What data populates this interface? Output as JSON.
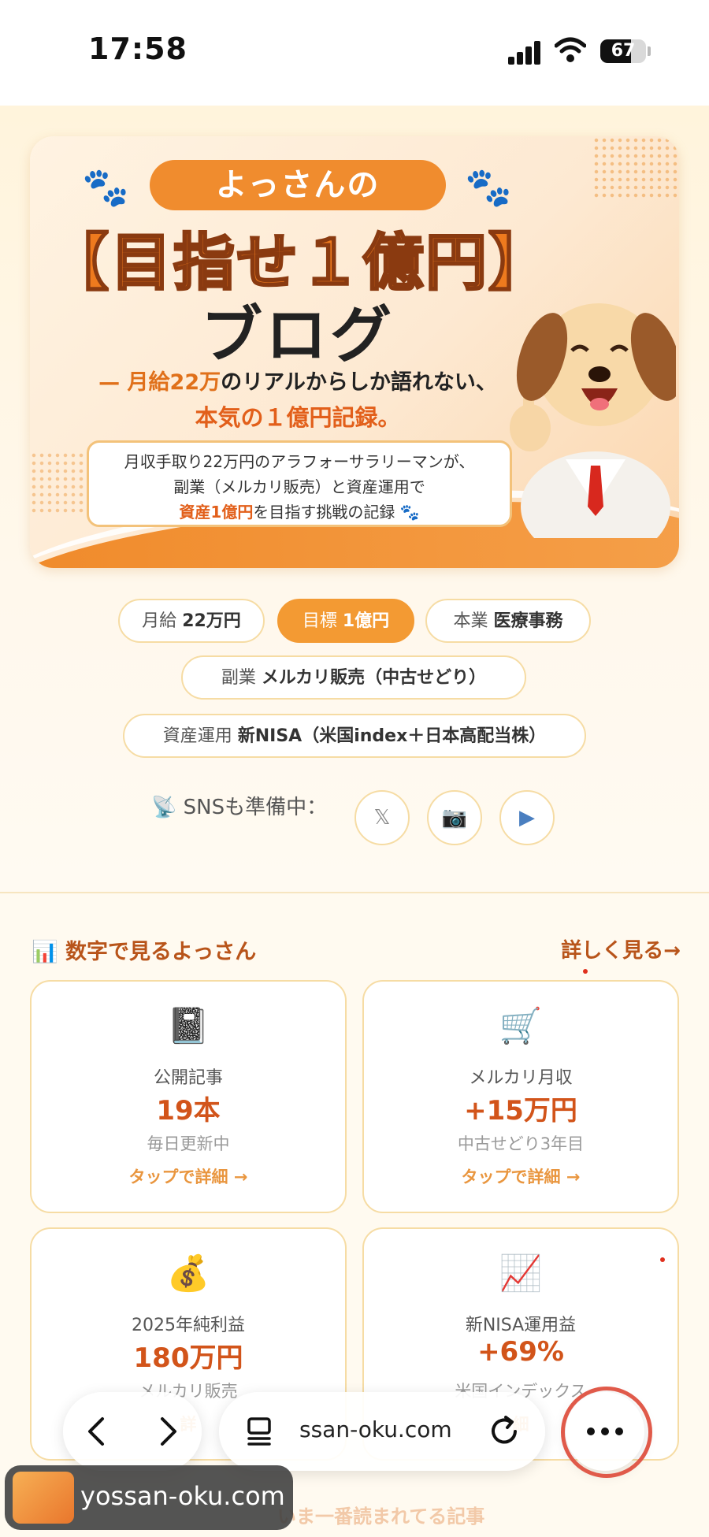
{
  "status_bar": {
    "time": "17:58",
    "battery": "67",
    "battery_level": 0.67
  },
  "hero": {
    "pill": "よっさんの",
    "title_line1": "【目指せ１億円】",
    "title_line2": "ブログ",
    "tagline_pre": "— 月給22万",
    "tagline_post": "のリアルからしか語れない、",
    "tagline2": "本気の１億円記録。",
    "desc_line1": "月収手取り22万円のアラフォーサラリーマンが、",
    "desc_line2": "副業（メルカリ販売）と資産運用で",
    "desc_line3_hl": "資産1億円",
    "desc_line3_rest": "を目指す挑戦の記録 🐾"
  },
  "profile": {
    "salary_label": "月給",
    "salary_value": "22万円",
    "goal_label": "目標",
    "goal_value": "1億円",
    "job_label": "本業",
    "job_value": "医療事務",
    "side_label": "副業",
    "side_value": "メルカリ販売（中古せどり）",
    "invest_label": "資産運用",
    "invest_value": "新NISA（米国index＋日本高配当株）"
  },
  "sns": {
    "label": "📡 SNSも準備中：",
    "x": "𝕏",
    "instagram": "📷",
    "youtube": "▶"
  },
  "stats": {
    "title": "📊 数字で見るよっさん",
    "more": "詳しく見る→",
    "cards": [
      {
        "icon": "📓",
        "label": "公開記事",
        "value": "19本",
        "sub": "毎日更新中",
        "link": "タップで詳細 →"
      },
      {
        "icon": "🛒",
        "label": "メルカリ月収",
        "value": "+15万円",
        "sub": "中古せどり3年目",
        "link": "タップで詳細 →"
      },
      {
        "icon": "💰",
        "label": "2025年純利益",
        "value": "180万円",
        "sub": "メルカリ販売",
        "link": "詳"
      },
      {
        "icon": "📈",
        "label": "新NISA運用益",
        "value": "+69%",
        "sub": "米国インデックス",
        "link": "細"
      }
    ]
  },
  "browser": {
    "back": "‹",
    "forward": "›",
    "url": "ssan-oku.com",
    "more": "•••"
  },
  "site_chip": {
    "text": "yossan-oku.com"
  },
  "fade_text": "いま一番読まれてる記事",
  "colors": {
    "accent": "#f08c2e",
    "accent_dark": "#b8541a",
    "value": "#d2541a",
    "chip_border": "#f6dca4"
  }
}
